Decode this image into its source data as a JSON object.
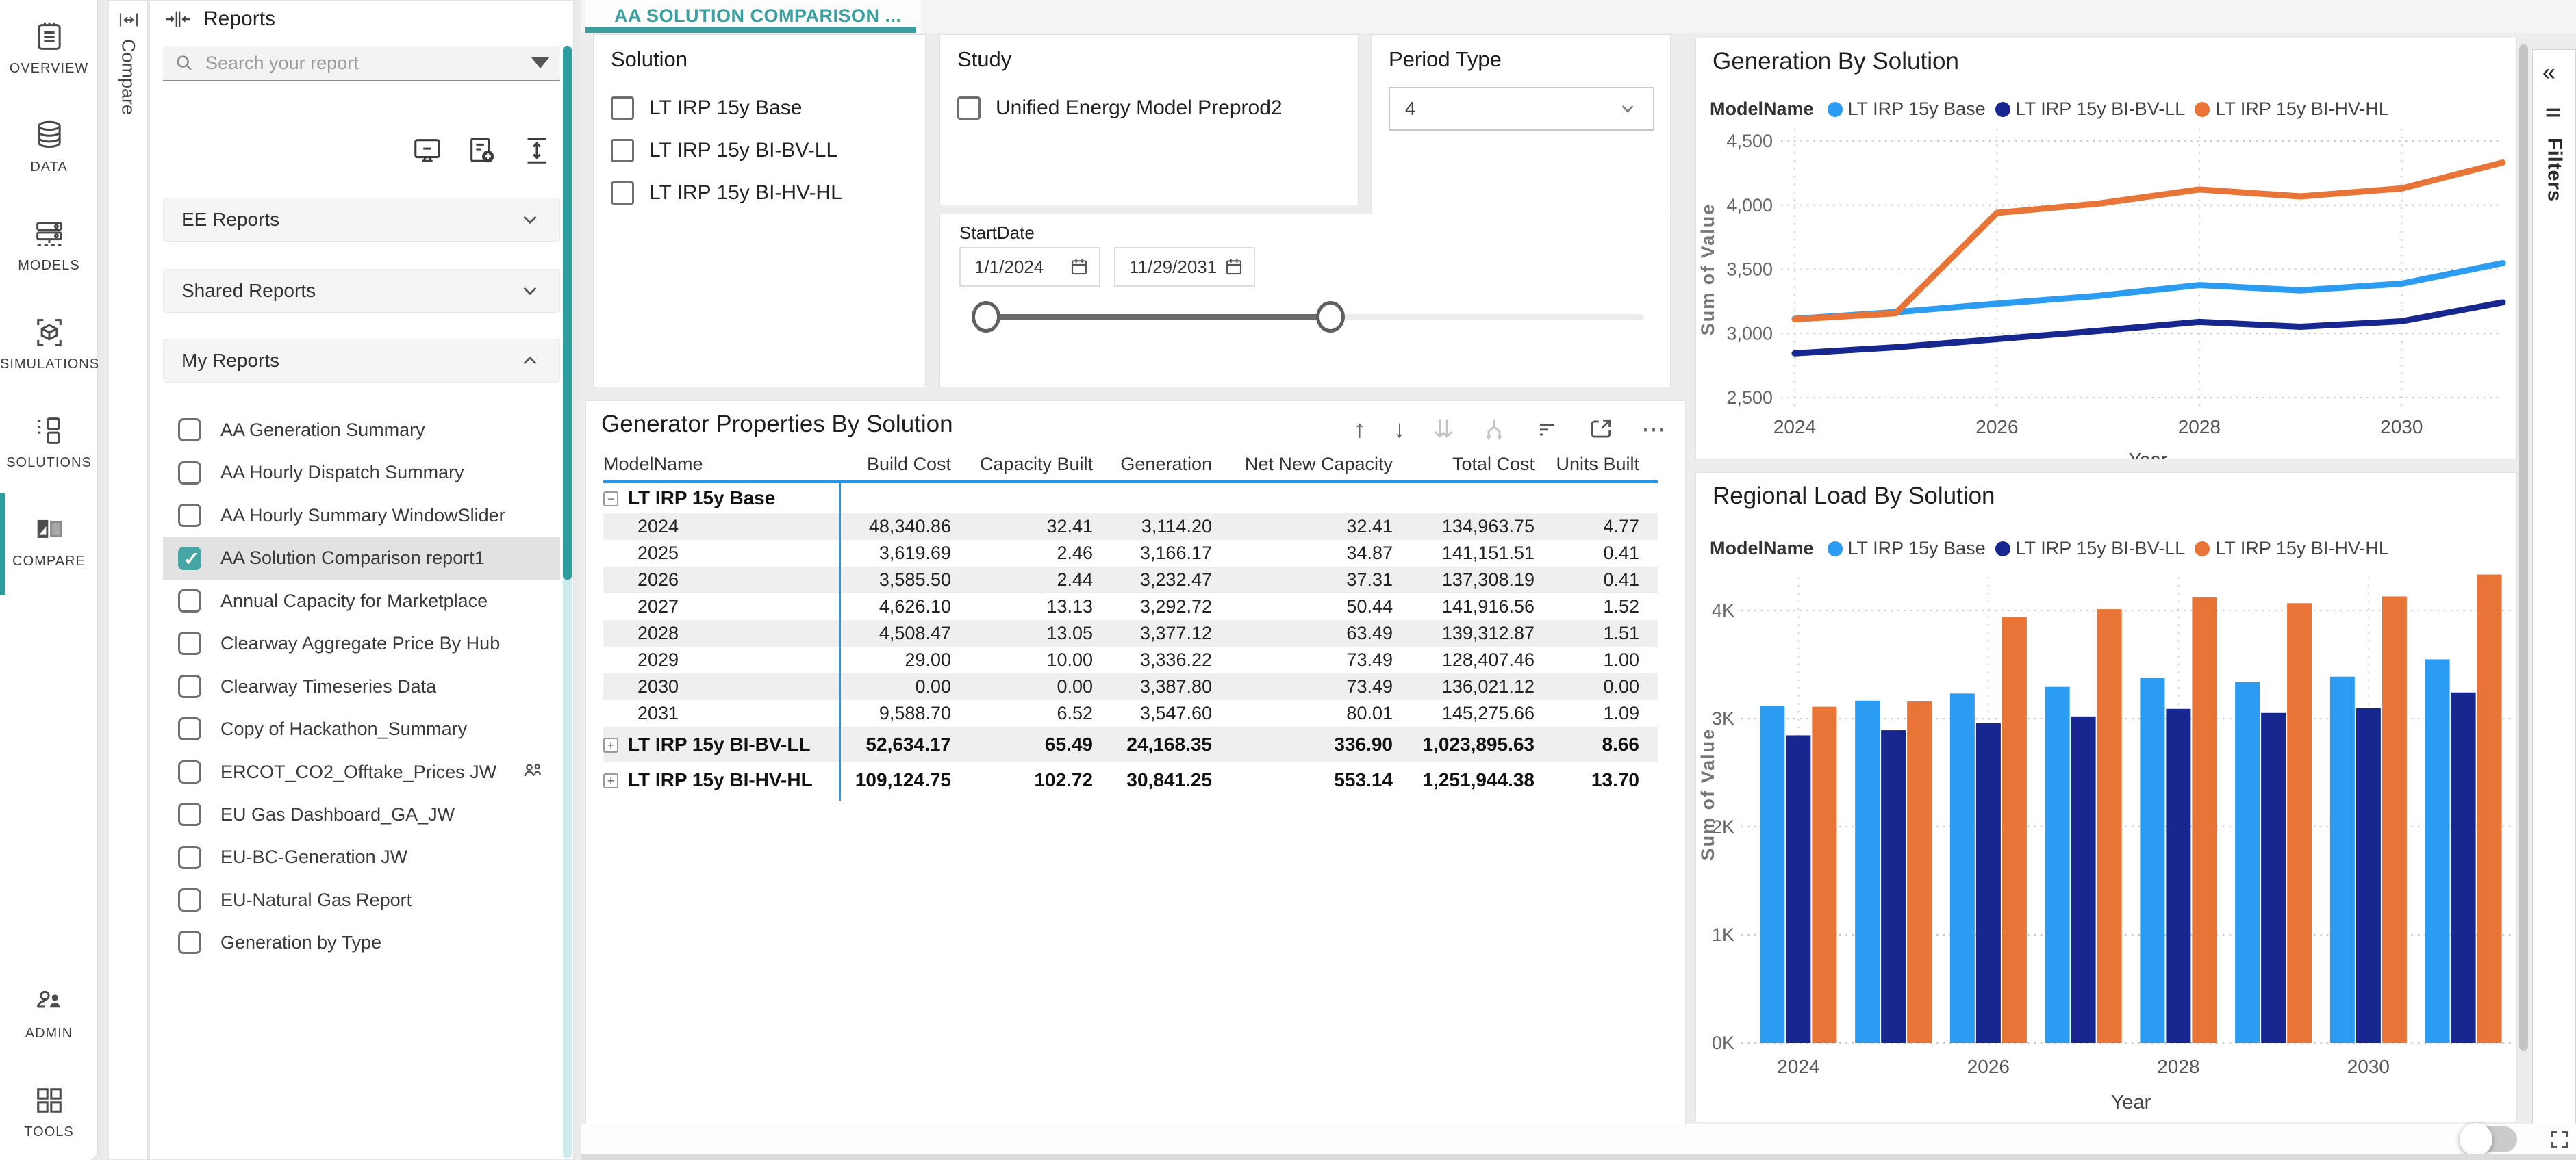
{
  "nav": {
    "items": [
      {
        "label": "OVERVIEW",
        "icon": "overview-icon",
        "top": 28,
        "active": false
      },
      {
        "label": "DATA",
        "icon": "data-icon",
        "top": 172,
        "active": false
      },
      {
        "label": "MODELS",
        "icon": "models-icon",
        "top": 316,
        "active": false
      },
      {
        "label": "SIMULATIONS",
        "icon": "simulations-icon",
        "top": 460,
        "active": false
      },
      {
        "label": "SOLUTIONS",
        "icon": "solutions-icon",
        "top": 604,
        "active": false
      },
      {
        "label": "COMPARE",
        "icon": "compare-icon",
        "top": 748,
        "active": true
      },
      {
        "label": "ADMIN",
        "icon": "admin-icon",
        "top": 1438,
        "active": false
      },
      {
        "label": "TOOLS",
        "icon": "tools-icon",
        "top": 1582,
        "active": false
      }
    ]
  },
  "compare_strip": {
    "label": "Compare"
  },
  "reports": {
    "title": "Reports",
    "search_placeholder": "Search your report",
    "sections": [
      {
        "label": "EE Reports",
        "expanded": false,
        "top": 288
      },
      {
        "label": "Shared Reports",
        "expanded": false,
        "top": 392
      },
      {
        "label": "My Reports",
        "expanded": true,
        "top": 494
      }
    ],
    "items": [
      {
        "label": "AA Generation Summary",
        "checked": false,
        "selected": false,
        "shared": false
      },
      {
        "label": "AA Hourly Dispatch Summary",
        "checked": false,
        "selected": false,
        "shared": false
      },
      {
        "label": "AA Hourly Summary WindowSlider",
        "checked": false,
        "selected": false,
        "shared": false
      },
      {
        "label": "AA Solution Comparison report1",
        "checked": true,
        "selected": true,
        "shared": false
      },
      {
        "label": "Annual Capacity for Marketplace",
        "checked": false,
        "selected": false,
        "shared": false
      },
      {
        "label": "Clearway Aggregate Price By Hub",
        "checked": false,
        "selected": false,
        "shared": false
      },
      {
        "label": "Clearway Timeseries Data",
        "checked": false,
        "selected": false,
        "shared": false
      },
      {
        "label": "Copy of Hackathon_Summary",
        "checked": false,
        "selected": false,
        "shared": false
      },
      {
        "label": "ERCOT_CO2_Offtake_Prices JW",
        "checked": false,
        "selected": false,
        "shared": true
      },
      {
        "label": "EU Gas Dashboard_GA_JW",
        "checked": false,
        "selected": false,
        "shared": false
      },
      {
        "label": "EU-BC-Generation JW",
        "checked": false,
        "selected": false,
        "shared": false
      },
      {
        "label": "EU-Natural Gas Report",
        "checked": false,
        "selected": false,
        "shared": false
      },
      {
        "label": "Generation by Type",
        "checked": false,
        "selected": false,
        "shared": false
      }
    ]
  },
  "tab": {
    "label": "AA SOLUTION COMPARISON ..."
  },
  "filters": {
    "solution": {
      "title": "Solution",
      "options": [
        "LT IRP 15y Base",
        "LT IRP 15y BI-BV-LL",
        "LT IRP 15y BI-HV-HL"
      ]
    },
    "study": {
      "title": "Study",
      "options": [
        "Unified Energy Model Preprod2"
      ]
    },
    "period_type": {
      "title": "Period Type",
      "value": "4"
    },
    "start_date": {
      "title": "StartDate",
      "from": "1/1/2024",
      "to": "11/29/2031"
    }
  },
  "table": {
    "title": "Generator Properties By Solution",
    "columns": [
      "ModelName",
      "Build Cost",
      "Capacity Built",
      "Generation",
      "Net New Capacity",
      "Total Cost",
      "Units Built"
    ],
    "groups": [
      {
        "name": "LT IRP 15y Base",
        "state": "expanded",
        "rows": [
          {
            "label": "2024",
            "values": [
              "48,340.86",
              "32.41",
              "3,114.20",
              "32.41",
              "134,963.75",
              "4.77"
            ]
          },
          {
            "label": "2025",
            "values": [
              "3,619.69",
              "2.46",
              "3,166.17",
              "34.87",
              "141,151.51",
              "0.41"
            ]
          },
          {
            "label": "2026",
            "values": [
              "3,585.50",
              "2.44",
              "3,232.47",
              "37.31",
              "137,308.19",
              "0.41"
            ]
          },
          {
            "label": "2027",
            "values": [
              "4,626.10",
              "13.13",
              "3,292.72",
              "50.44",
              "141,916.56",
              "1.52"
            ]
          },
          {
            "label": "2028",
            "values": [
              "4,508.47",
              "13.05",
              "3,377.12",
              "63.49",
              "139,312.87",
              "1.51"
            ]
          },
          {
            "label": "2029",
            "values": [
              "29.00",
              "10.00",
              "3,336.22",
              "73.49",
              "128,407.46",
              "1.00"
            ]
          },
          {
            "label": "2030",
            "values": [
              "0.00",
              "0.00",
              "3,387.80",
              "73.49",
              "136,021.12",
              "0.00"
            ]
          },
          {
            "label": "2031",
            "values": [
              "9,588.70",
              "6.52",
              "3,547.60",
              "80.01",
              "145,275.66",
              "1.09"
            ]
          }
        ]
      },
      {
        "name": "LT IRP 15y BI-BV-LL",
        "state": "collapsed",
        "totals": [
          "52,634.17",
          "65.49",
          "24,168.35",
          "336.90",
          "1,023,895.63",
          "8.66"
        ]
      },
      {
        "name": "LT IRP 15y BI-HV-HL",
        "state": "collapsed",
        "totals": [
          "109,124.75",
          "102.72",
          "30,841.25",
          "553.14",
          "1,251,944.38",
          "13.70"
        ]
      }
    ]
  },
  "chart_data": [
    {
      "type": "line",
      "title": "Generation By Solution",
      "legend_title": "ModelName",
      "x": [
        2024,
        2025,
        2026,
        2027,
        2028,
        2029,
        2030,
        2031
      ],
      "series": [
        {
          "name": "LT IRP 15y Base",
          "color": "#2b9cf2",
          "values": [
            3114,
            3166,
            3232,
            3293,
            3377,
            3336,
            3388,
            3548
          ]
        },
        {
          "name": "LT IRP 15y BI-BV-LL",
          "color": "#17278f",
          "values": [
            2845,
            2892,
            2956,
            3020,
            3090,
            3052,
            3095,
            3242
          ]
        },
        {
          "name": "LT IRP 15y BI-HV-HL",
          "color": "#e87437",
          "values": [
            3110,
            3158,
            3940,
            4012,
            4122,
            4068,
            4130,
            4332
          ]
        }
      ],
      "xlabel": "Year",
      "ylabel": "Sum of Value",
      "ylim": [
        2500,
        4500
      ],
      "yticks": [
        2500,
        3000,
        3500,
        4000,
        4500
      ],
      "ytick_labels": [
        "2,500",
        "3,000",
        "3,500",
        "4,000",
        "4,500"
      ],
      "xticks": [
        2024,
        2026,
        2028,
        2030
      ],
      "grid": true,
      "legend_position": "top"
    },
    {
      "type": "bar",
      "title": "Regional Load By Solution",
      "legend_title": "ModelName",
      "categories": [
        2024,
        2025,
        2026,
        2027,
        2028,
        2029,
        2030,
        2031
      ],
      "series": [
        {
          "name": "LT IRP 15y Base",
          "color": "#2b9cf2",
          "values": [
            3114,
            3166,
            3232,
            3293,
            3377,
            3336,
            3388,
            3548
          ]
        },
        {
          "name": "LT IRP 15y BI-BV-LL",
          "color": "#17278f",
          "values": [
            2845,
            2892,
            2956,
            3020,
            3090,
            3052,
            3095,
            3242
          ]
        },
        {
          "name": "LT IRP 15y BI-HV-HL",
          "color": "#e87437",
          "values": [
            3110,
            3158,
            3940,
            4012,
            4122,
            4068,
            4130,
            4332
          ]
        }
      ],
      "xlabel": "Year",
      "ylabel": "Sum of Value",
      "ylim": [
        0,
        4600
      ],
      "yticks": [
        0,
        1000,
        2000,
        3000,
        4000
      ],
      "ytick_labels": [
        "0K",
        "1K",
        "2K",
        "3K",
        "4K"
      ],
      "xticks": [
        2024,
        2026,
        2028,
        2030
      ],
      "grid": true,
      "legend_position": "top"
    }
  ],
  "right_strip": {
    "label": "Filters"
  },
  "bottom_bar": {
    "toggle_on": false
  },
  "colors": {
    "accent_teal": "#3a9d9d",
    "table_header_line": "#2196f3"
  }
}
